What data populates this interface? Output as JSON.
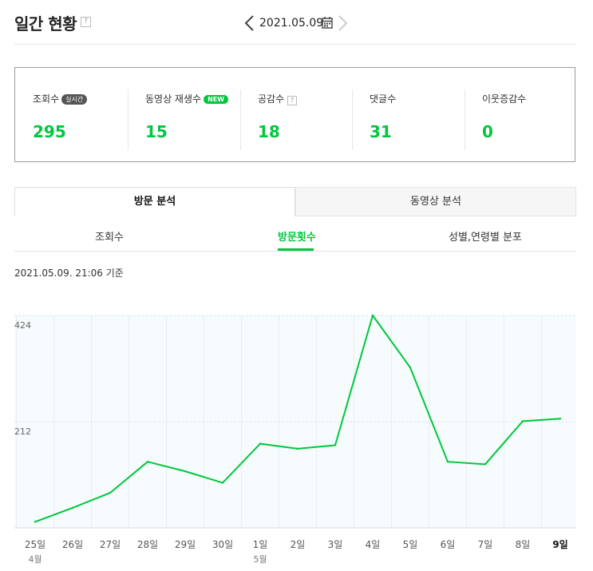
{
  "header": {
    "title": "일간 현황",
    "help_glyph": "?",
    "date": "2021.05.09.",
    "prev_icon": "chevron-left-icon",
    "next_icon": "chevron-right-icon",
    "calendar_icon": "calendar-icon"
  },
  "stats": [
    {
      "label": "조회수",
      "badge": "실시간",
      "value": "295"
    },
    {
      "label": "동영상 재생수",
      "badge": "NEW",
      "value": "15"
    },
    {
      "label": "공감수",
      "help": "?",
      "value": "18"
    },
    {
      "label": "댓글수",
      "value": "31"
    },
    {
      "label": "이웃증감수",
      "value": "0"
    }
  ],
  "tabs": [
    {
      "label": "방문 분석",
      "active": true
    },
    {
      "label": "동영상 분석",
      "active": false
    }
  ],
  "subtabs": [
    {
      "label": "조회수",
      "active": false
    },
    {
      "label": "방문횟수",
      "active": true
    },
    {
      "label": "성별,연령별 분포",
      "active": false
    }
  ],
  "timestamp": "2021.05.09. 21:06 기준",
  "colors": {
    "accent": "#00c73c",
    "grid": "#e8eef3",
    "plot_bg": "#f6fbfd"
  },
  "chart_data": {
    "type": "line",
    "x": [
      "25일",
      "26일",
      "27일",
      "28일",
      "29일",
      "30일",
      "1일",
      "2일",
      "3일",
      "4일",
      "5일",
      "6일",
      "7일",
      "8일",
      "9일"
    ],
    "month_labels": [
      {
        "index": 0,
        "label": "4월"
      },
      {
        "index": 6,
        "label": "5월"
      }
    ],
    "highlight_index": 14,
    "values": [
      12,
      40,
      70,
      132,
      113,
      90,
      168,
      158,
      165,
      424,
      320,
      132,
      127,
      213,
      218
    ],
    "yticks": [
      212,
      424
    ],
    "ylim": [
      0,
      424
    ],
    "grid": true
  }
}
